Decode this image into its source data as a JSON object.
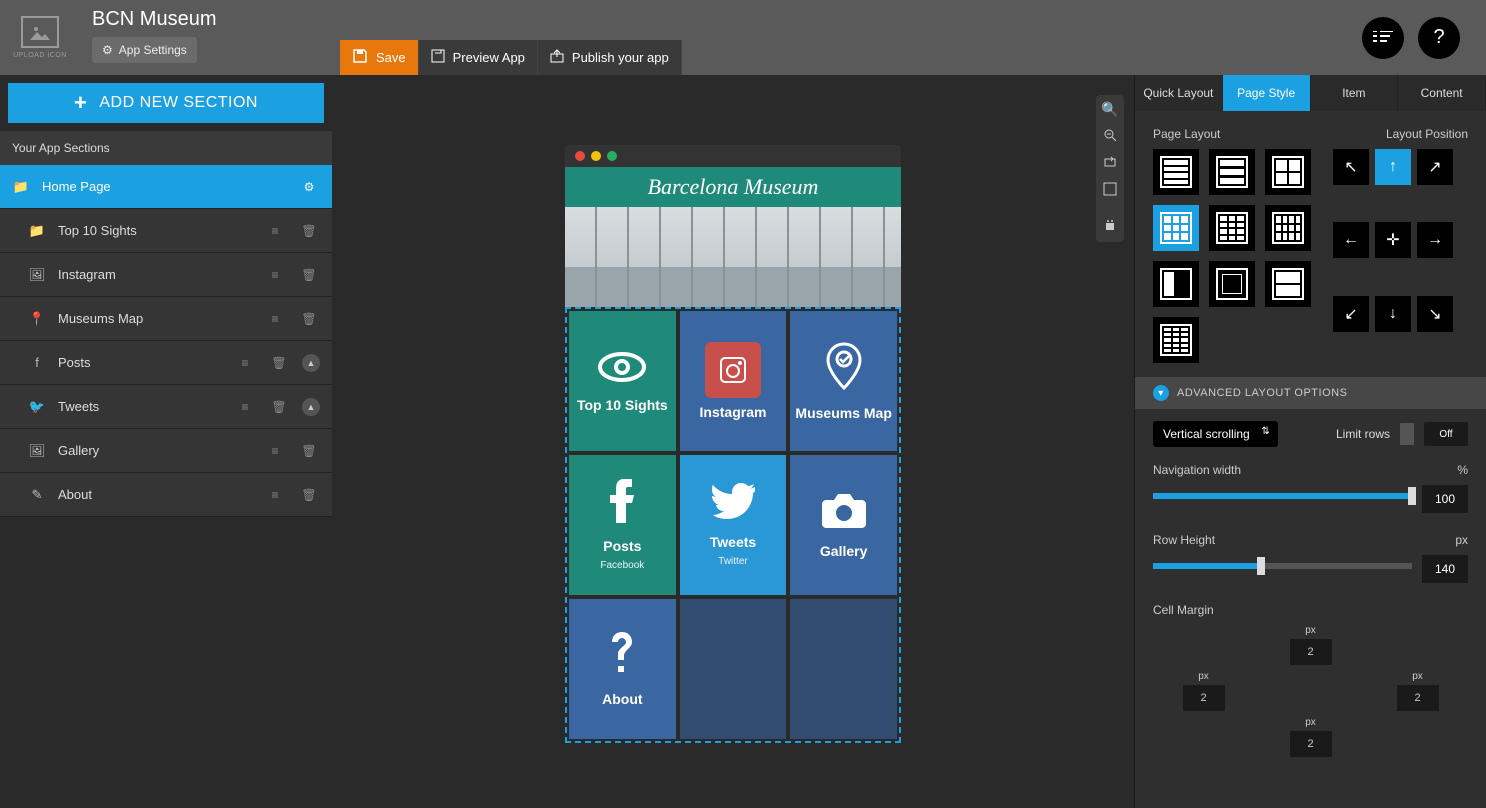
{
  "app": {
    "title": "BCN Museum",
    "settings_label": "App Settings",
    "upload_label": "UPLOAD ICON"
  },
  "toolbar": {
    "save": "Save",
    "preview": "Preview App",
    "publish": "Publish your app"
  },
  "topright": {
    "list_icon": "list-icon",
    "help_icon": "?"
  },
  "sidebar": {
    "add_label": "ADD NEW SECTION",
    "header": "Your App Sections",
    "items": [
      {
        "label": "Home Page",
        "icon": "📁",
        "active": true,
        "gear": true
      },
      {
        "label": "Top 10 Sights",
        "icon": "📁",
        "sub": true,
        "trash": true
      },
      {
        "label": "Instagram",
        "icon": "🖼",
        "sub": true,
        "trash": true
      },
      {
        "label": "Museums Map",
        "icon": "📍",
        "sub": true,
        "trash": true
      },
      {
        "label": "Posts",
        "icon": "f",
        "sub": true,
        "trash": true,
        "caret": true
      },
      {
        "label": "Tweets",
        "icon": "🐦",
        "sub": true,
        "trash": true,
        "caret": true
      },
      {
        "label": "Gallery",
        "icon": "🖼",
        "sub": true,
        "trash": true
      },
      {
        "label": "About",
        "icon": "✎",
        "sub": true,
        "trash": true
      }
    ]
  },
  "preview": {
    "header": "Barcelona Museum",
    "tiles": [
      {
        "label": "Top 10 Sights",
        "color": "teal",
        "icon": "eye"
      },
      {
        "label": "Instagram",
        "color": "insta",
        "icon": "instagram"
      },
      {
        "label": "Museums Map",
        "color": "blue",
        "icon": "pin"
      },
      {
        "label": "Posts",
        "sub": "Facebook",
        "color": "teal",
        "icon": "facebook"
      },
      {
        "label": "Tweets",
        "sub": "Twitter",
        "color": "twitter",
        "icon": "twitter"
      },
      {
        "label": "Gallery",
        "color": "blue",
        "icon": "camera"
      },
      {
        "label": "About",
        "color": "blue",
        "icon": "question"
      }
    ]
  },
  "canvas_tools": [
    "zoom-in",
    "zoom-out",
    "rotate",
    "fullscreen",
    "apple",
    "android"
  ],
  "right": {
    "tabs": [
      "Quick Layout",
      "Page Style",
      "Item",
      "Content"
    ],
    "active_tab": 1,
    "page_layout_label": "Page Layout",
    "layout_position_label": "Layout Position",
    "advanced_header": "ADVANCED LAYOUT OPTIONS",
    "scroll_select": "Vertical scrolling",
    "limit_rows_label": "Limit rows",
    "limit_rows_value": "Off",
    "nav_width_label": "Navigation width",
    "nav_width_unit": "%",
    "nav_width_value": "100",
    "row_height_label": "Row Height",
    "row_height_unit": "px",
    "row_height_value": "140",
    "cell_margin_label": "Cell Margin",
    "margins": {
      "top": "2",
      "right": "2",
      "bottom": "2",
      "left": "2",
      "unit": "px"
    }
  }
}
